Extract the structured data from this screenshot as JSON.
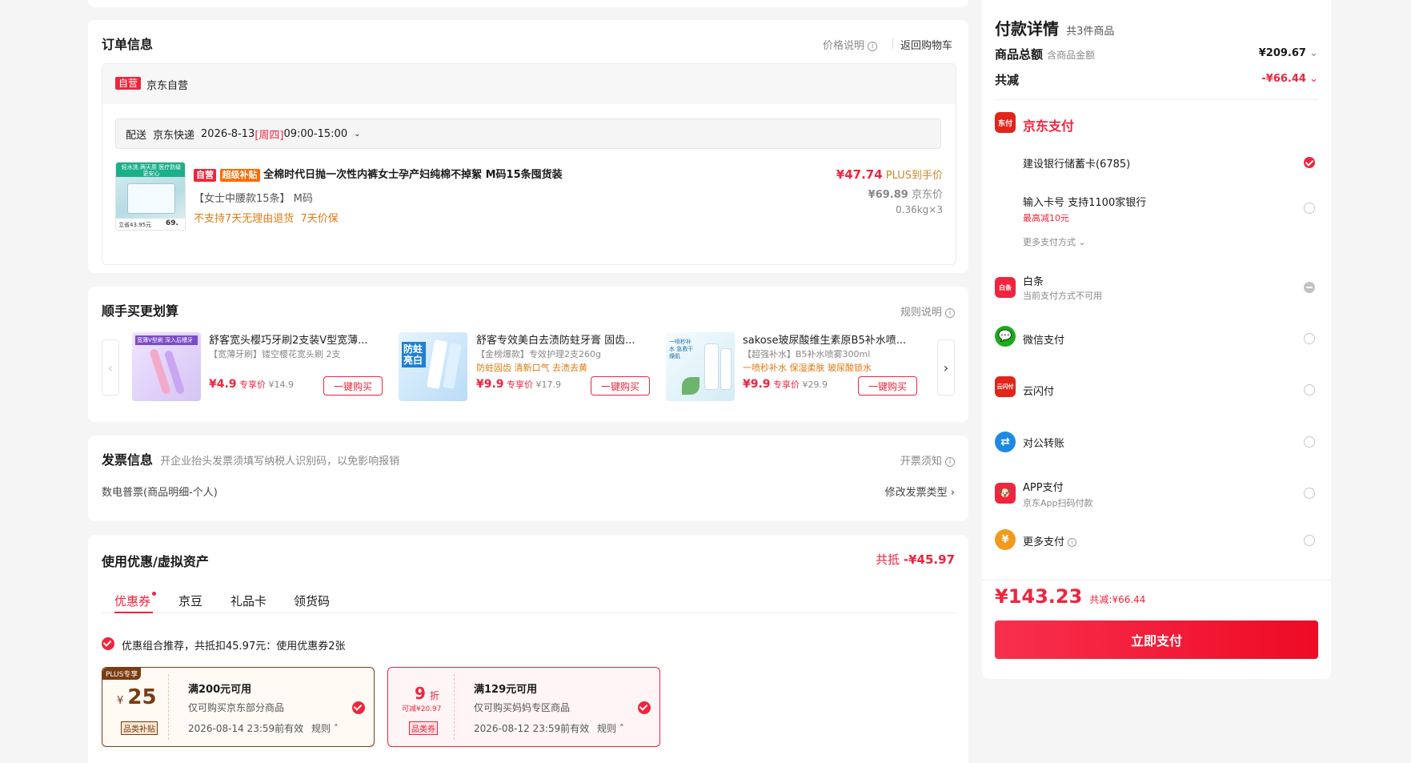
{
  "order": {
    "title": "订单信息",
    "price_help": "价格说明",
    "back_cart": "返回购物车",
    "shop_tag": "自营",
    "shop_name": "京东自营",
    "delivery_label": "配送",
    "delivery_carrier": "京东快递",
    "delivery_date": "2026-8-13",
    "delivery_weekday": "[周四]",
    "delivery_time": "09:00-15:00",
    "product": {
      "tag_self": "自营",
      "tag_subsidy": "超级补贴",
      "name": "全棉时代日抛一次性内裤女士孕产妇纯棉不掉絮 M码15条囤货装",
      "spec": "【女士中腰款15条】 M码",
      "policy": "不支持7天无理由退货  7天价保",
      "plus_price": "¥47.74",
      "plus_label": "PLUS到手价",
      "jd_price": "¥69.89",
      "jd_label": "京东价",
      "qty": "0.36kg×3",
      "thumb_top": "轻水洗 两天质 医疗防级更安心",
      "thumb_price_left": "立省43.95元",
      "thumb_price_right": "69."
    }
  },
  "addon": {
    "title": "顺手买更划算",
    "rules": "规则说明",
    "items": [
      {
        "name": "舒客宽头樱巧牙刷2支装V型宽薄...",
        "desc": "【宽薄牙刷】镂空樱花宽头刷 2支",
        "price": "¥4.9",
        "price_label": "专享价",
        "orig": "¥14.9",
        "btn": "一键购买",
        "thumb_text": "宽薄V型刷 深入后槽牙"
      },
      {
        "name": "舒客专效美白去渍防蛀牙膏 固齿...",
        "desc": "【金榜爆款】专效护理2支260g",
        "tags": "防蛀固齿 清新口气 去渍去黄",
        "price": "¥9.9",
        "price_label": "专享价",
        "orig": "¥17.9",
        "btn": "一键购买",
        "thumb_text": "防蛀 亮白"
      },
      {
        "name": "sakose玻尿酸维生素原B5补水喷...",
        "desc": "【超强补水】B5补水喷雾300ml",
        "tags": "一喷秒补水 保湿柔肤 玻尿酸锁水",
        "price": "¥9.9",
        "price_label": "专享价",
        "orig": "¥29.9",
        "btn": "一键购买",
        "thumb_text": "一喷秒补水 急救干燥肌"
      }
    ]
  },
  "invoice": {
    "title": "发票信息",
    "hint": "开企业抬头发票须填写纳税人识别码，以免影响报销",
    "notice": "开票须知",
    "type": "数电普票(商品明细-个人)",
    "modify": "修改发票类型"
  },
  "discount": {
    "title": "使用优惠/虚拟资产",
    "total_label": "共抵",
    "total_value": "-¥45.97",
    "tabs": [
      "优惠券",
      "京豆",
      "礼品卡",
      "领货码"
    ],
    "recommend": "优惠组合推荐，共抵扣45.97元：使用优惠券2张",
    "coupons": [
      {
        "badge": "PLUS专享",
        "currency": "¥",
        "amount": "25",
        "type": "品类补贴",
        "threshold": "满200元可用",
        "scope": "仅可购买京东部分商品",
        "expiry": "2026-08-14 23:59前有效",
        "rule": "规则"
      },
      {
        "amount": "9",
        "unit": "折",
        "sub": "可减¥20.97",
        "type": "品类券",
        "threshold": "满129元可用",
        "scope": "仅可购买妈妈专区商品",
        "expiry": "2026-08-12 23:59前有效",
        "rule": "规则"
      }
    ]
  },
  "payment": {
    "title": "付款详情",
    "count": "共3件商品",
    "goods_total_label": "商品总额",
    "goods_total_sub": "含商品金额",
    "goods_total_value": "¥209.67",
    "reduce_label": "共减",
    "reduce_value": "-¥66.44",
    "jdpay_title": "京东支付",
    "jdpay_icon": "东付",
    "methods": {
      "card": "建设银行储蓄卡(6785)",
      "input_card": "输入卡号 支持1100家银行",
      "input_card_promo": "最高减10元",
      "more_methods": "更多支付方式",
      "baitiao": "白条",
      "baitiao_sub": "当前支付方式不可用",
      "baitiao_icon": "白条",
      "wechat": "微信支付",
      "unionpay": "云闪付",
      "unionpay_icon": "云闪付",
      "transfer": "对公转账",
      "app": "APP支付",
      "app_sub": "京东App扫码付款",
      "more": "更多支付",
      "more_icon": "¥"
    },
    "final_price": "¥143.23",
    "final_reduce": "共减:¥66.44",
    "submit": "立即支付"
  },
  "colors": {
    "accent": "#f0243c",
    "orange": "#e07a10",
    "wechat": "#1aad19",
    "transfer": "#1e88e5"
  }
}
